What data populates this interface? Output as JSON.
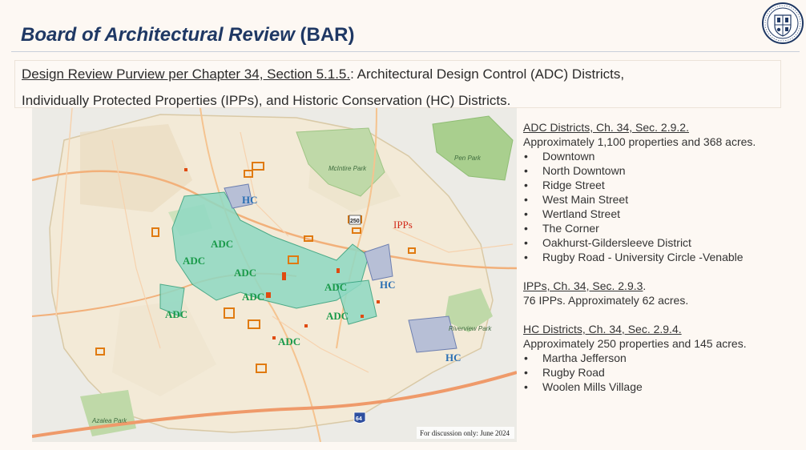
{
  "header": {
    "title_italic": "Board of Architectural Review",
    "title_rest": " (BAR)"
  },
  "purview": {
    "link_text": "Design Review Purview per Chapter 34, Section 5.1.5.",
    "line1_rest": ": Architectural Design Control (ADC) Districts,",
    "line2": "Individually Protected Properties (IPPs), and Historic Conservation (HC) Districts."
  },
  "map": {
    "adc_label": "ADC",
    "hc_label": "HC",
    "ipp_label": "IPPs",
    "parks": {
      "mcintire": "McIntire Park",
      "pen": "Pen Park",
      "riverview": "Riverview Park",
      "azalea": "Azalea Park"
    },
    "route_250": "250",
    "route_64": "64",
    "footnote": "For discussion only: June 2024",
    "colors": {
      "adc": "#1a9a4a",
      "hc": "#2a6fb3",
      "ipp": "#d22a1a",
      "ipp_outline": "#e07a10",
      "adc_fill": "#8fd9c3",
      "hc_fill": "#b7bfd6"
    }
  },
  "adc": {
    "heading": "ADC Districts, Ch. 34, Sec. 2.9.2.",
    "summary": "Approximately 1,100 properties and 368 acres.",
    "items": [
      "Downtown",
      "North Downtown",
      "Ridge Street",
      "West Main Street",
      "Wertland Street",
      "The Corner",
      "Oakhurst-Gildersleeve District",
      "Rugby Road - University Circle -Venable"
    ]
  },
  "ipp": {
    "heading": "IPPs, Ch. 34, Sec. 2.9.3",
    "heading_suffix": ".",
    "summary": "76 IPPs. Approximately 62 acres."
  },
  "hc": {
    "heading": "HC Districts, Ch. 34, Sec. 2.9.4.",
    "summary": "Approximately 250 properties and 145 acres.",
    "items": [
      "Martha Jefferson",
      "Rugby Road",
      "Woolen Mills Village"
    ]
  }
}
